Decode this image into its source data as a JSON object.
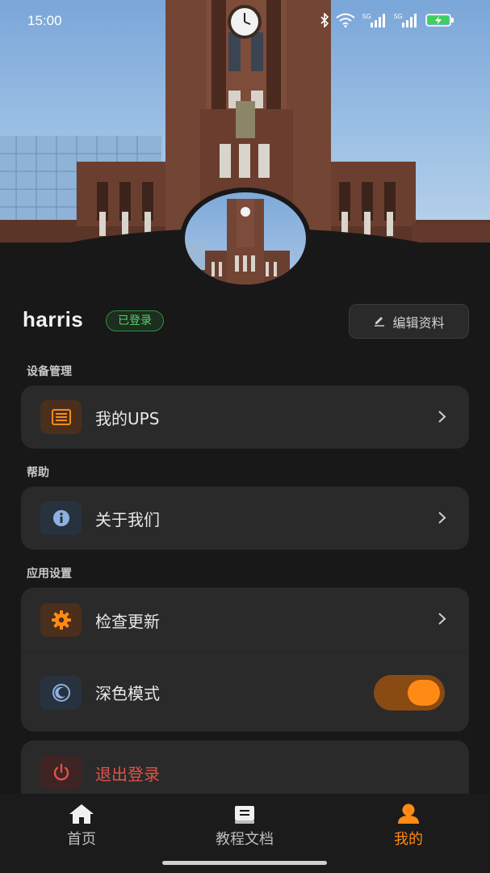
{
  "status_bar": {
    "time": "15:00",
    "icons": [
      "bluetooth-icon",
      "wifi-icon",
      "signal-5g-icon",
      "signal-5g-icon",
      "battery-charging-icon"
    ],
    "network_label_1": "5G",
    "network_label_2": "5G"
  },
  "profile": {
    "username": "harris",
    "login_status": "已登录",
    "edit_label": "编辑资料"
  },
  "sections": {
    "device": {
      "title": "设备管理",
      "items": [
        {
          "label": "我的UPS",
          "icon": "ups-device-icon"
        }
      ]
    },
    "help": {
      "title": "帮助",
      "items": [
        {
          "label": "关于我们",
          "icon": "info-icon"
        }
      ]
    },
    "settings": {
      "title": "应用设置",
      "items": [
        {
          "label": "检查更新",
          "icon": "gear-icon"
        },
        {
          "label": "深色模式",
          "icon": "dark-mode-icon",
          "toggle_on": true
        }
      ]
    },
    "logout": {
      "label": "退出登录",
      "icon": "power-icon"
    }
  },
  "bottom_nav": {
    "items": [
      {
        "label": "首页",
        "icon": "home-icon",
        "active": false
      },
      {
        "label": "教程文档",
        "icon": "book-icon",
        "active": false
      },
      {
        "label": "我的",
        "icon": "profile-icon",
        "active": true
      }
    ]
  },
  "colors": {
    "accent": "#ff8a15",
    "background": "#181818",
    "card": "#2a2a2a",
    "success": "#5ad16c",
    "danger": "#e0524a"
  }
}
